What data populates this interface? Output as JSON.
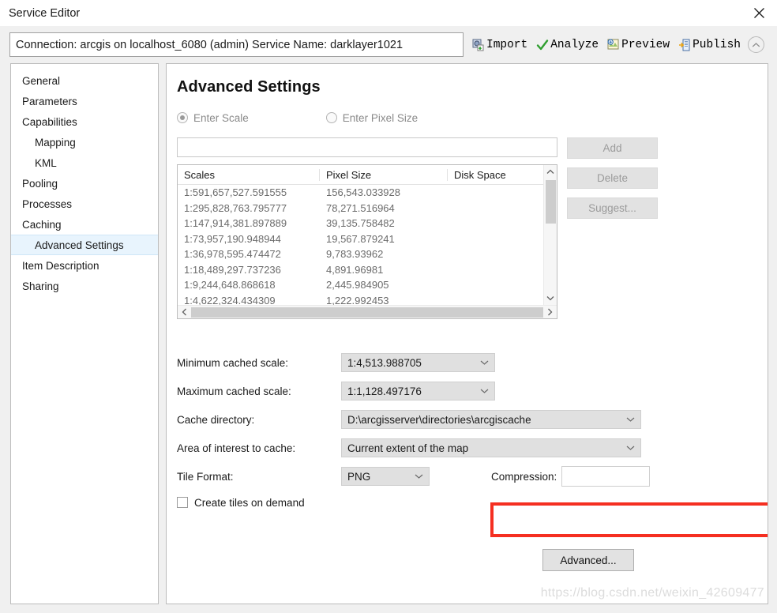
{
  "window": {
    "title": "Service Editor",
    "close_icon": "close-icon"
  },
  "connection_bar": {
    "field_value": "Connection: arcgis on localhost_6080 (admin)   Service Name: darklayer1021",
    "buttons": [
      {
        "label": "Import",
        "icon": "import-icon"
      },
      {
        "label": "Analyze",
        "icon": "check-icon"
      },
      {
        "label": "Preview",
        "icon": "preview-icon"
      },
      {
        "label": "Publish",
        "icon": "publish-icon"
      }
    ],
    "collapse_icon": "chevron-up-icon"
  },
  "sidebar": {
    "items": [
      {
        "label": "General",
        "indent": false,
        "selected": false
      },
      {
        "label": "Parameters",
        "indent": false,
        "selected": false
      },
      {
        "label": "Capabilities",
        "indent": false,
        "selected": false
      },
      {
        "label": "Mapping",
        "indent": true,
        "selected": false
      },
      {
        "label": "KML",
        "indent": true,
        "selected": false
      },
      {
        "label": "Pooling",
        "indent": false,
        "selected": false
      },
      {
        "label": "Processes",
        "indent": false,
        "selected": false
      },
      {
        "label": "Caching",
        "indent": false,
        "selected": false
      },
      {
        "label": "Advanced Settings",
        "indent": true,
        "selected": true
      },
      {
        "label": "Item Description",
        "indent": false,
        "selected": false
      },
      {
        "label": "Sharing",
        "indent": false,
        "selected": false
      }
    ]
  },
  "content": {
    "page_title": "Advanced Settings",
    "radios": [
      {
        "label": "Enter Scale",
        "checked": true
      },
      {
        "label": "Enter Pixel Size",
        "checked": false
      }
    ],
    "scale_input_value": "",
    "table": {
      "columns": [
        "Scales",
        "Pixel Size",
        "Disk Space"
      ],
      "rows": [
        [
          "1:591,657,527.591555",
          "156,543.033928",
          ""
        ],
        [
          "1:295,828,763.795777",
          "78,271.516964",
          ""
        ],
        [
          "1:147,914,381.897889",
          "39,135.758482",
          ""
        ],
        [
          "1:73,957,190.948944",
          "19,567.879241",
          ""
        ],
        [
          "1:36,978,595.474472",
          "9,783.93962",
          ""
        ],
        [
          "1:18,489,297.737236",
          "4,891.96981",
          ""
        ],
        [
          "1:9,244,648.868618",
          "2,445.984905",
          ""
        ],
        [
          "1:4,622,324.434309",
          "1,222.992453",
          ""
        ]
      ]
    },
    "side_buttons": [
      {
        "label": "Add"
      },
      {
        "label": "Delete"
      },
      {
        "label": "Suggest..."
      }
    ],
    "form": {
      "min_scale_label": "Minimum cached scale:",
      "min_scale_value": "1:4,513.988705",
      "max_scale_label": "Maximum cached scale:",
      "max_scale_value": "1:1,128.497176",
      "cache_dir_label": "Cache directory:",
      "cache_dir_value": "D:\\arcgisserver\\directories\\arcgiscache",
      "aoi_label": "Area of interest to cache:",
      "aoi_value": "Current extent of the map",
      "tile_format_label": "Tile Format:",
      "tile_format_value": "PNG",
      "compression_label": "Compression:",
      "compression_value": "",
      "create_tiles_label": "Create tiles on demand",
      "create_tiles_checked": false
    },
    "advanced_button_label": "Advanced...",
    "watermark": "https://blog.csdn.net/weixin_42609477"
  },
  "colors": {
    "accent_red": "#f52f21",
    "selection_blue": "#e8f4fd",
    "panel_bg": "#f0f0f0",
    "control_gray": "#e0e0e0"
  }
}
